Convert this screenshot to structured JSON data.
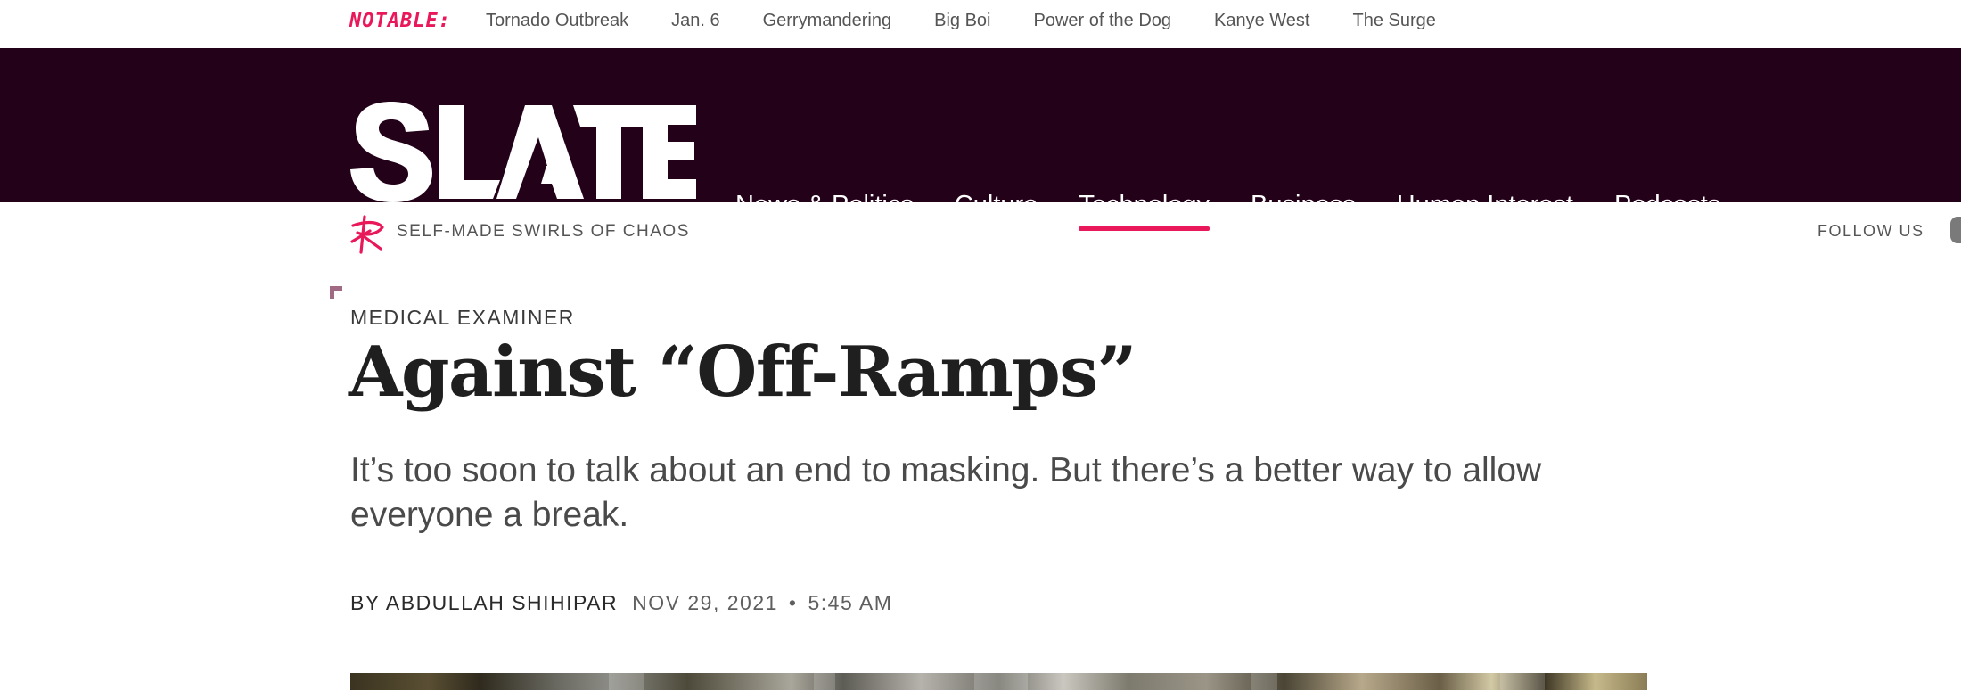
{
  "notable": {
    "label": "NOTABLE:",
    "links": [
      "Tornado Outbreak",
      "Jan. 6",
      "Gerrymandering",
      "Big Boi",
      "Power of the Dog",
      "Kanye West",
      "The Surge"
    ]
  },
  "masthead": {
    "logo_text": "SLATE",
    "nav": [
      {
        "label": "News & Politics",
        "active": false
      },
      {
        "label": "Culture",
        "active": false
      },
      {
        "label": "Technology",
        "active": true
      },
      {
        "label": "Business",
        "active": false
      },
      {
        "label": "Human Interest",
        "active": false
      },
      {
        "label": "Podcasts",
        "active": false
      }
    ]
  },
  "subheader": {
    "tagline": "SELF-MADE SWIRLS OF CHAOS",
    "follow_us": "FOLLOW US"
  },
  "article": {
    "kicker": "MEDICAL EXAMINER",
    "headline": "Against “Off-Ramps”",
    "dek": "It’s too soon to talk about an end to masking. But there’s a better way to allow everyone a break.",
    "byline": "BY ABDULLAH SHIHIPAR",
    "date": "NOV 29, 2021",
    "separator": "•",
    "time": "5:45 AM"
  },
  "colors": {
    "accent": "#e8185a",
    "masthead_bg": "#230119",
    "headline": "#1f1f1f",
    "body_text": "#4a4a4a"
  },
  "icons": {
    "tagline_icon": "slate-squiggle-icon",
    "corner_mark": "corner-bracket-icon"
  }
}
